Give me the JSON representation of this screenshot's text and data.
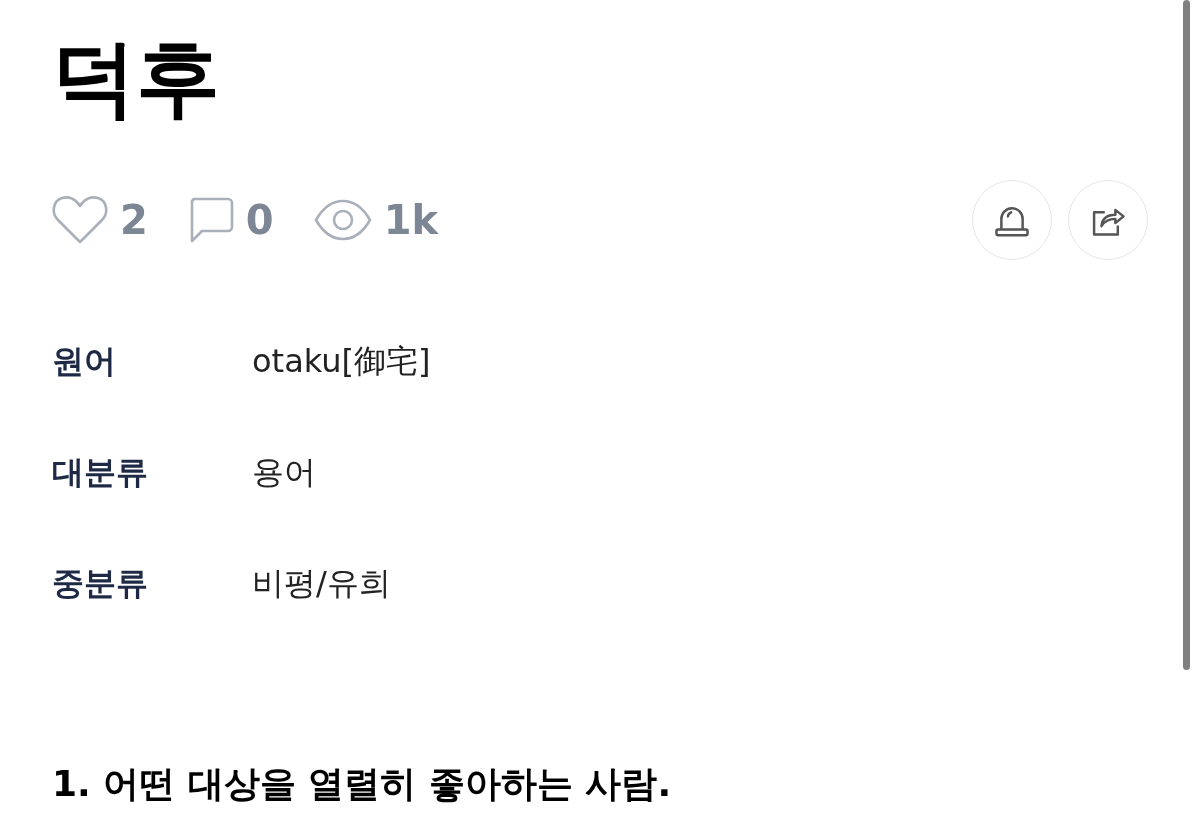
{
  "title": "덕후",
  "stats": [
    {
      "kind": "likes",
      "count": "2"
    },
    {
      "kind": "comments",
      "count": "0"
    },
    {
      "kind": "views",
      "count": "1k"
    }
  ],
  "actions": [
    {
      "kind": "report"
    },
    {
      "kind": "share"
    }
  ],
  "info": [
    {
      "label": "원어",
      "value": "otaku[御宅]"
    },
    {
      "label": "대분류",
      "value": "용어"
    },
    {
      "label": "중분류",
      "value": "비평/유희"
    }
  ],
  "definitions": [
    {
      "text": "1. 어떤 대상을 열렬히 좋아하는 사람."
    }
  ]
}
